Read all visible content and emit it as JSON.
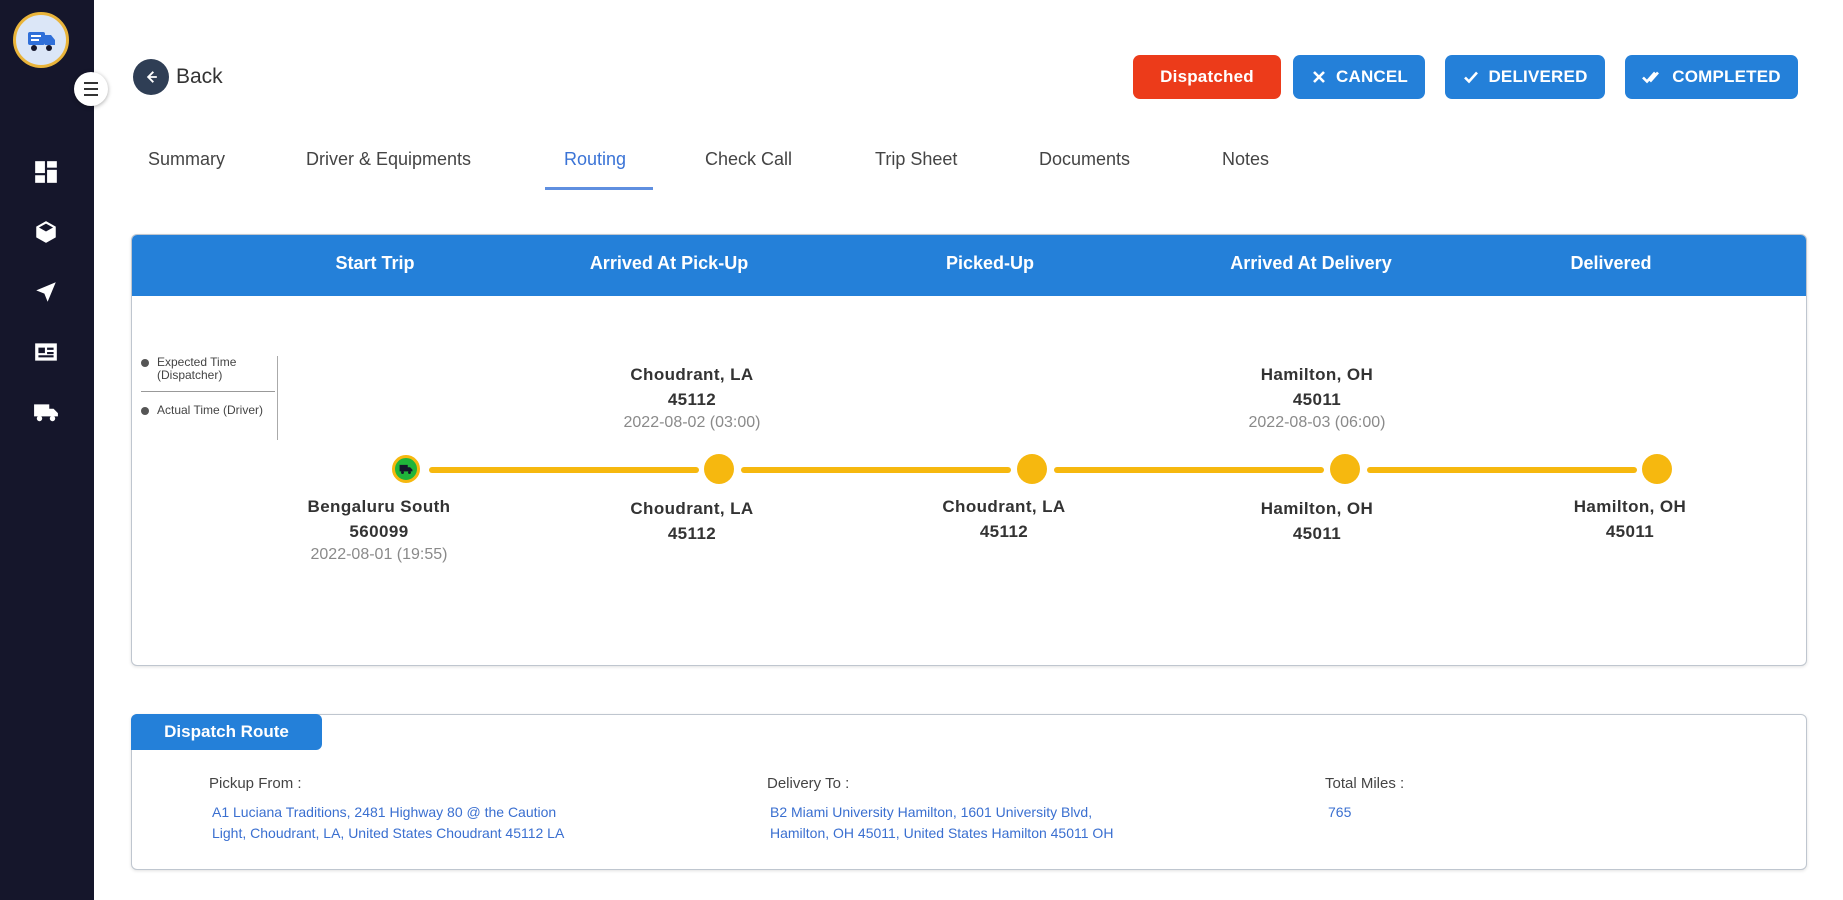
{
  "sidebar": {
    "logo_icon": "truck-logo-icon",
    "menu_icon": "hamburger-menu-icon",
    "items": [
      {
        "icon": "dashboard-icon"
      },
      {
        "icon": "package-icon"
      },
      {
        "icon": "navigation-arrow-icon"
      },
      {
        "icon": "id-card-icon"
      },
      {
        "icon": "truck-icon"
      }
    ]
  },
  "header": {
    "back_label": "Back",
    "status": "Dispatched",
    "actions": {
      "cancel": "CANCEL",
      "delivered": "DELIVERED",
      "completed": "COMPLETED"
    }
  },
  "tabs": [
    {
      "label": "Summary"
    },
    {
      "label": "Driver & Equipments"
    },
    {
      "label": "Routing",
      "active": true
    },
    {
      "label": "Check Call"
    },
    {
      "label": "Trip Sheet"
    },
    {
      "label": "Documents"
    },
    {
      "label": "Notes"
    }
  ],
  "routing": {
    "stages": [
      "Start Trip",
      "Arrived At Pick-Up",
      "Picked-Up",
      "Arrived At Delivery",
      "Delivered"
    ],
    "legend": {
      "expected": "Expected Time (Dispatcher)",
      "actual": "Actual Time (Driver)"
    },
    "expected": [
      {
        "city": "Choudrant, LA",
        "zip": "45112",
        "time": "2022-08-02 (03:00)"
      },
      {
        "city": "Hamilton, OH",
        "zip": "45011",
        "time": "2022-08-03 (06:00)"
      }
    ],
    "actual": [
      {
        "city": "Bengaluru South",
        "zip": "560099",
        "time": "2022-08-01 (19:55)"
      },
      {
        "city": "Choudrant, LA",
        "zip": "45112"
      },
      {
        "city": "Choudrant, LA",
        "zip": "45112"
      },
      {
        "city": "Hamilton, OH",
        "zip": "45011"
      },
      {
        "city": "Hamilton, OH",
        "zip": "45011"
      }
    ],
    "colors": {
      "track": "#f6b80f",
      "start_node": "#20b53a",
      "header": "#2480d9"
    }
  },
  "dispatch_route": {
    "title": "Dispatch Route",
    "pickup_label": "Pickup From :",
    "pickup_line1": "A1 Luciana Traditions, 2481 Highway 80 @ the Caution",
    "pickup_line2": "Light, Choudrant, LA, United States Choudrant 45112 LA",
    "delivery_label": "Delivery To :",
    "delivery_line1": "B2 Miami University Hamilton, 1601 University Blvd,",
    "delivery_line2": "Hamilton, OH 45011, United States Hamilton 45011 OH",
    "miles_label": "Total Miles :",
    "miles_value": "765"
  }
}
